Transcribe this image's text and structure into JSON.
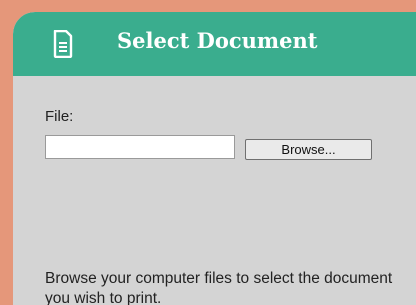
{
  "dialog": {
    "title": "Select Document",
    "icon": "document-icon"
  },
  "file_field": {
    "label": "File:",
    "value": "",
    "placeholder": ""
  },
  "browse_button": {
    "label": "Browse..."
  },
  "help_text": "Browse your computer files to select the document you wish to print.",
  "colors": {
    "background": "#e5977a",
    "header": "#3aad8e",
    "panel": "#d4d4d4",
    "header_text": "#ffffff"
  }
}
